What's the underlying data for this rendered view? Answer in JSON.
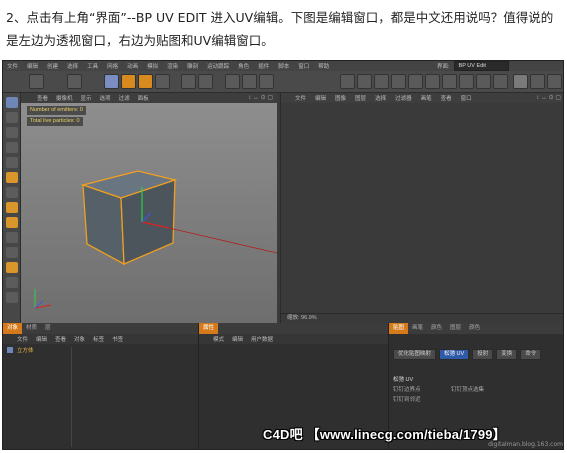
{
  "caption": "2、点击有上角“界面”--BP UV EDIT 进入UV编辑。下图是编辑窗口，都是中文还用说吗？值得说的是左边为透视窗口，右边为贴图和UV编辑窗口。",
  "app": {
    "menubar": [
      "文件",
      "编辑",
      "创建",
      "选择",
      "工具",
      "网格",
      "动画",
      "模拟",
      "渲染",
      "雕刻",
      "运动跟踪",
      "角色",
      "插件",
      "脚本",
      "窗口",
      "帮助"
    ],
    "layout_label": "界面:",
    "layout_value": "BP UV Edit"
  },
  "viewport": {
    "menu": [
      "查看",
      "摄像机",
      "显示",
      "选项",
      "过滤",
      "面板"
    ],
    "stats": [
      "Number of emitters: 0",
      "Total live particles: 0"
    ],
    "controls": "↕ ↔ ⊙ ▢"
  },
  "uv_editor": {
    "menu": [
      "文件",
      "编辑",
      "图像",
      "图层",
      "选择",
      "过滤器",
      "画笔",
      "查看",
      "窗口"
    ],
    "controls": "↕ ↔ ⊙ ▢",
    "zoom": "缩放: 96.9%"
  },
  "objects_panel": {
    "tabs": [
      "对象",
      "材质",
      "层"
    ],
    "menu": [
      "文件",
      "编辑",
      "查看",
      "对象",
      "标签",
      "书签"
    ],
    "object_name": "立方体"
  },
  "attributes_panel": {
    "tabs": [
      "属性"
    ],
    "menu": [
      "模式",
      "编辑",
      "用户数据"
    ]
  },
  "uv_panel": {
    "tabs": [
      "贴图",
      "画笔",
      "颜色",
      "图层",
      "颜色"
    ],
    "modes": [
      "优化贴图映射",
      "松弛 UV",
      "投射",
      "变换",
      "命令"
    ],
    "section": "松弛 UV",
    "options": [
      "钉钉边界点",
      "钉钉到邻近",
      "钉钉顶点选集"
    ]
  },
  "watermark": "C4D吧 【www.linecg.com/tieba/1799】",
  "blog": "digitalman.blog.163.com"
}
